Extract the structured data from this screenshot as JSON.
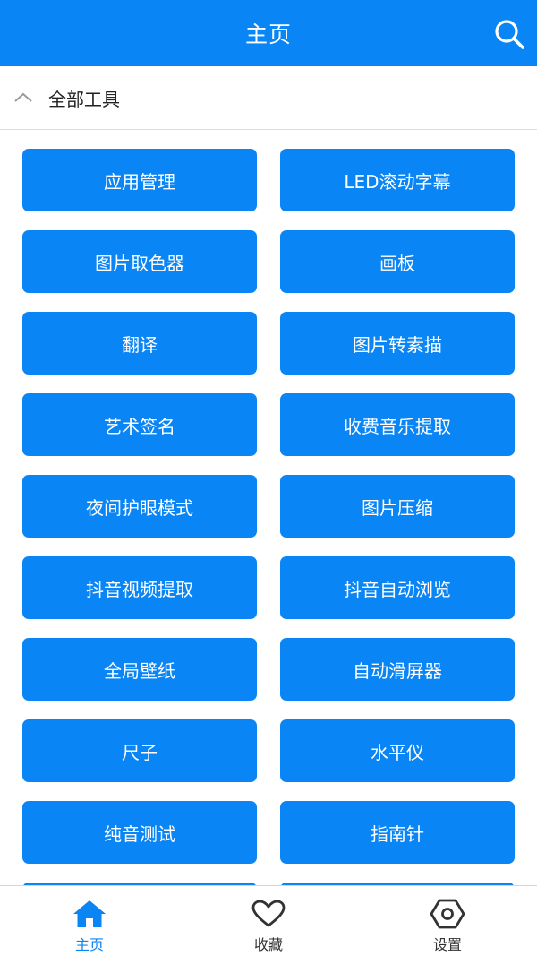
{
  "header": {
    "title": "主页"
  },
  "section": {
    "label": "全部工具"
  },
  "tools": [
    "应用管理",
    "LED滚动字幕",
    "图片取色器",
    "画板",
    "翻译",
    "图片转素描",
    "艺术签名",
    "收费音乐提取",
    "夜间护眼模式",
    "图片压缩",
    "抖音视频提取",
    "抖音自动浏览",
    "全局壁纸",
    "自动滑屏器",
    "尺子",
    "水平仪",
    "纯音测试",
    "指南针",
    "",
    ""
  ],
  "tabs": [
    {
      "label": "主页",
      "icon": "home-icon",
      "active": true
    },
    {
      "label": "收藏",
      "icon": "heart-icon",
      "active": false
    },
    {
      "label": "设置",
      "icon": "settings-icon",
      "active": false
    }
  ],
  "colors": {
    "accent": "#0a85f5",
    "text": "#222222",
    "inactive_icon": "#333333"
  }
}
